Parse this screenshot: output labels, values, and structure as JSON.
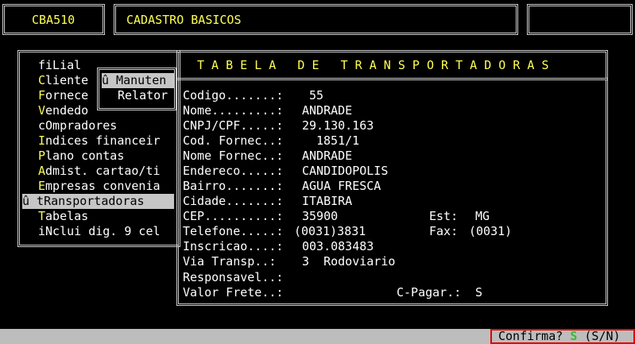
{
  "header": {
    "program_code": "CBA510",
    "title": "CADASTRO BASICOS",
    "right_box": ""
  },
  "menu": {
    "items": [
      {
        "hot": "",
        "label": "fiLial"
      },
      {
        "hot": "C",
        "label": "liente"
      },
      {
        "hot": "F",
        "label": "ornece"
      },
      {
        "hot": "V",
        "label": "endedo"
      },
      {
        "hot": "",
        "label": "cOmpradores"
      },
      {
        "hot": "I",
        "label": "ndices financeir"
      },
      {
        "hot": "P",
        "label": "lano contas"
      },
      {
        "hot": "A",
        "label": "dmist. cartao/ti"
      },
      {
        "hot": "E",
        "label": "mpresas convenia"
      },
      {
        "hot": "",
        "label": "û tRansportadoras"
      },
      {
        "hot": "T",
        "label": "abelas"
      },
      {
        "hot": "",
        "label": "iNclui dig. 9 cel"
      }
    ],
    "submenu": {
      "manutencao": "û Manuten",
      "relatorio": "Relator"
    }
  },
  "form": {
    "title": "T A B E L A   D E   T R A N S P O R T A D O R A S",
    "fields": {
      "codigo_label": "Codigo.......:",
      "codigo_value": "55",
      "nome_label": "Nome.........:",
      "nome_value": "ANDRADE",
      "cnpj_label": "CNPJ/CPF.....:",
      "cnpj_value": "29.130.163",
      "codfornec_label": "Cod. Fornec..:",
      "codfornec_value": "1851/1",
      "nomefornec_label": "Nome Fornec..:",
      "nomefornec_value": "ANDRADE",
      "endereco_label": "Endereco.....:",
      "endereco_value": "CANDIDOPOLIS",
      "bairro_label": "Bairro.......:",
      "bairro_value": "AGUA FRESCA",
      "cidade_label": "Cidade.......:",
      "cidade_value": "ITABIRA",
      "cep_label": "CEP..........:",
      "cep_value": "35900",
      "est_label": "Est:",
      "est_value": "MG",
      "telefone_label": "Telefone.....:",
      "telefone_value": "(0031)3831",
      "fax_label": "Fax:",
      "fax_value": "(0031)",
      "inscricao_label": "Inscricao....:",
      "inscricao_value": "003.083483",
      "viatransp_label": "Via Transp..:",
      "viatransp_value": "3  Rodoviario",
      "responsavel_label": "Responsavel..:",
      "responsavel_value": "",
      "valorfrete_label": "Valor Frete..:",
      "valorfrete_value": "",
      "cpagar_label": "C-Pagar.:",
      "cpagar_value": "S"
    }
  },
  "status_bar": {
    "prompt": "Confirma?",
    "answer": "S",
    "options": "(S/N)"
  },
  "colors": {
    "background": "#000000",
    "highlight_text": "#ffff55",
    "selection_bg": "#c6c6c6",
    "status_bar_bg": "#bdbdbd",
    "confirm_border": "#e00000",
    "confirm_answer": "#2fbf2f"
  }
}
